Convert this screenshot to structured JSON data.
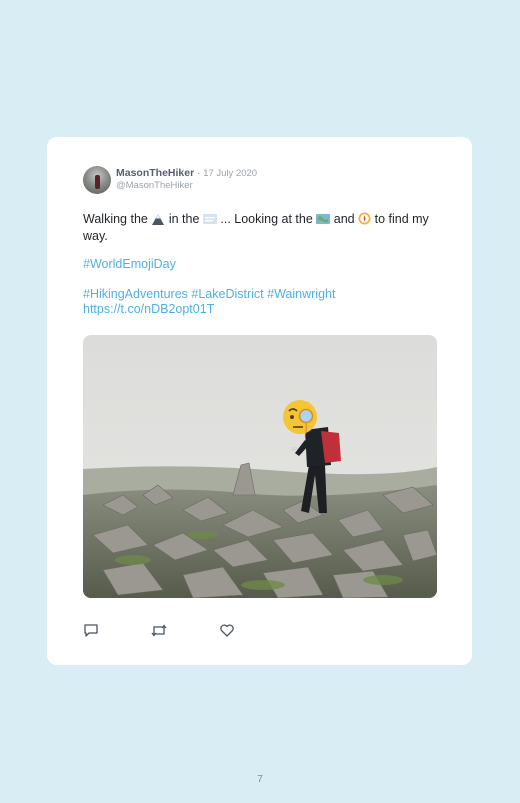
{
  "tweet": {
    "display_name": "MasonTheHiker",
    "separator": "·",
    "date": "17 July 2020",
    "handle": "@MasonTheHiker",
    "line1": {
      "a": "Walking the",
      "emoji1": "mountain-icon",
      "b": "in the",
      "emoji2": "fog-icon",
      "c": "... Looking at the",
      "emoji3": "map-icon",
      "d": "and",
      "emoji4": "compass-icon",
      "e": "to find my way."
    },
    "hashtag_line": "#WorldEmojiDay",
    "hashtags": [
      "#HikingAdventures",
      "#LakeDistrict",
      "#Wainwright"
    ],
    "url": "https://t.co/nDB2opt01T",
    "media": {
      "subject": "hiker-on-rocky-summit-with-cairn",
      "overlay_emoji": "face-with-monocle-icon"
    },
    "actions": [
      {
        "name": "reply-icon"
      },
      {
        "name": "retweet-icon"
      },
      {
        "name": "like-icon"
      }
    ]
  },
  "page_number": "7",
  "colors": {
    "background": "#d9eef4",
    "card": "#ffffff",
    "link": "#4fb0e3",
    "muted": "#9aa3ad"
  }
}
